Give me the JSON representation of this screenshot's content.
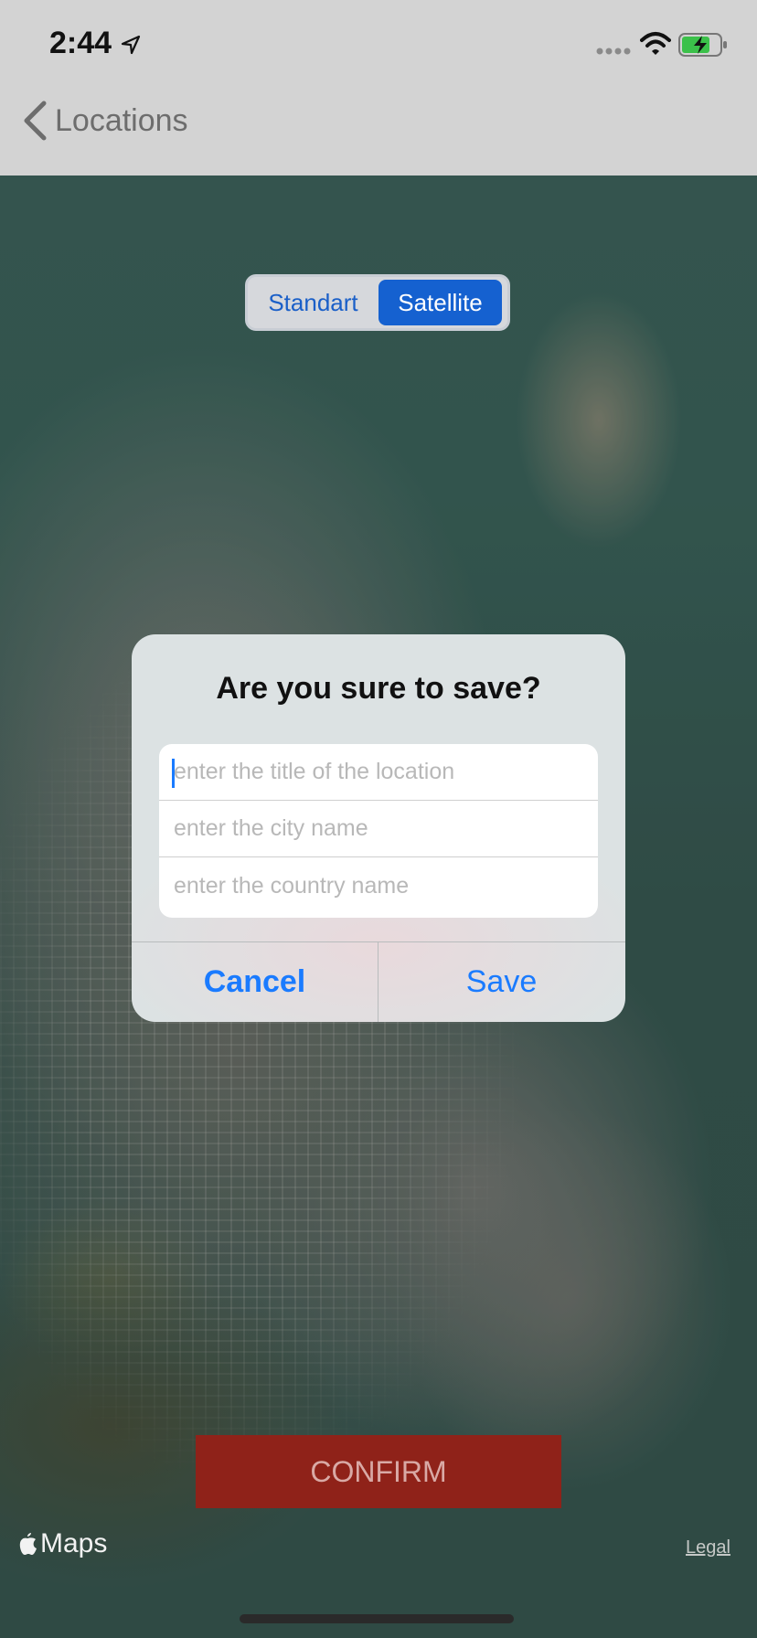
{
  "status_bar": {
    "time": "2:44",
    "icons": [
      "location-arrow-icon",
      "signal-dots-icon",
      "wifi-icon",
      "battery-charging-icon"
    ]
  },
  "nav": {
    "back_label": "Locations",
    "back_icon": "chevron-left-icon"
  },
  "map_type": {
    "options": [
      "Standart",
      "Satellite"
    ],
    "selected": "Satellite"
  },
  "alert": {
    "title": "Are you sure to save?",
    "fields": [
      {
        "placeholder": "enter the title of the location",
        "value": ""
      },
      {
        "placeholder": "enter the city name",
        "value": ""
      },
      {
        "placeholder": "enter the country name",
        "value": ""
      }
    ],
    "cancel_label": "Cancel",
    "save_label": "Save"
  },
  "confirm_label": "CONFIRM",
  "map_footer": {
    "logo_text": "Maps",
    "legal_label": "Legal"
  },
  "colors": {
    "accent": "#1a7bff",
    "segment_selected": "#1561d0",
    "confirm_bg": "#8f2219"
  }
}
